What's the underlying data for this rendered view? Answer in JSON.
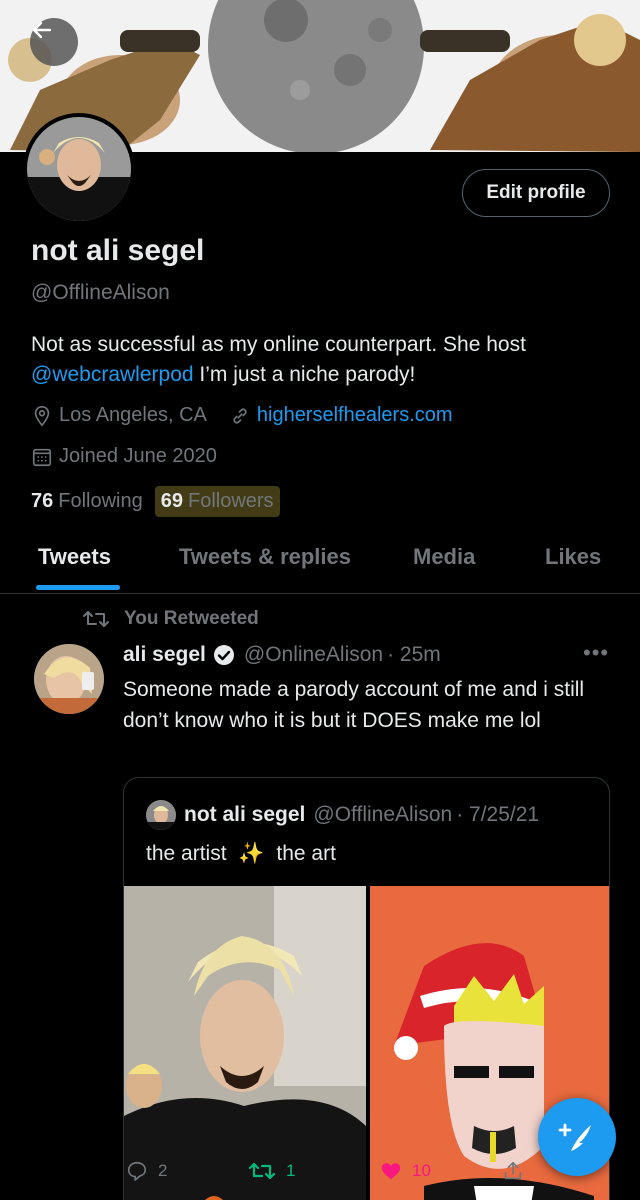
{
  "profile": {
    "name": "not ali segel",
    "handle": "@OfflineAlison",
    "edit_label": "Edit profile",
    "bio_text": "Not as successful as my online counterpart. She host",
    "bio_mention": "@webcrawlerpod",
    "bio_tail": " I’m just a niche parody!",
    "location": "Los Angeles, CA",
    "website": "higherselfhealers.com",
    "joined": "Joined June 2020",
    "following_count": "76",
    "following_label": "Following",
    "followers_count": "69",
    "followers_label": "Followers"
  },
  "tabs": [
    {
      "label": "Tweets",
      "active": true
    },
    {
      "label": "Tweets & replies",
      "active": false
    },
    {
      "label": "Media",
      "active": false
    },
    {
      "label": "Likes",
      "active": false
    }
  ],
  "tweet": {
    "retweet_note": "You Retweeted",
    "author_name": "ali segel",
    "author_handle": "@OnlineAlison",
    "time": "· 25m",
    "text": "Someone made a parody account of me and i still don’t know who it is but it DOES make me lol",
    "quote": {
      "author_name": "not ali segel",
      "author_handle": "@OfflineAlison",
      "date": "· 7/25/21",
      "text_a": "the artist",
      "text_b": "the art"
    },
    "reply_count": "2",
    "retweet_count": "1",
    "like_count": "10"
  },
  "colors": {
    "accent": "#1d9bf0",
    "like": "#f91880",
    "retweet": "#00ba7c",
    "muted": "#71767b"
  },
  "icons": [
    "back-arrow-icon",
    "location-pin-icon",
    "link-icon",
    "calendar-icon",
    "retweet-icon",
    "verified-badge-icon",
    "more-icon",
    "reply-icon",
    "like-icon",
    "share-icon",
    "compose-tweet-icon",
    "sparkles-icon"
  ]
}
